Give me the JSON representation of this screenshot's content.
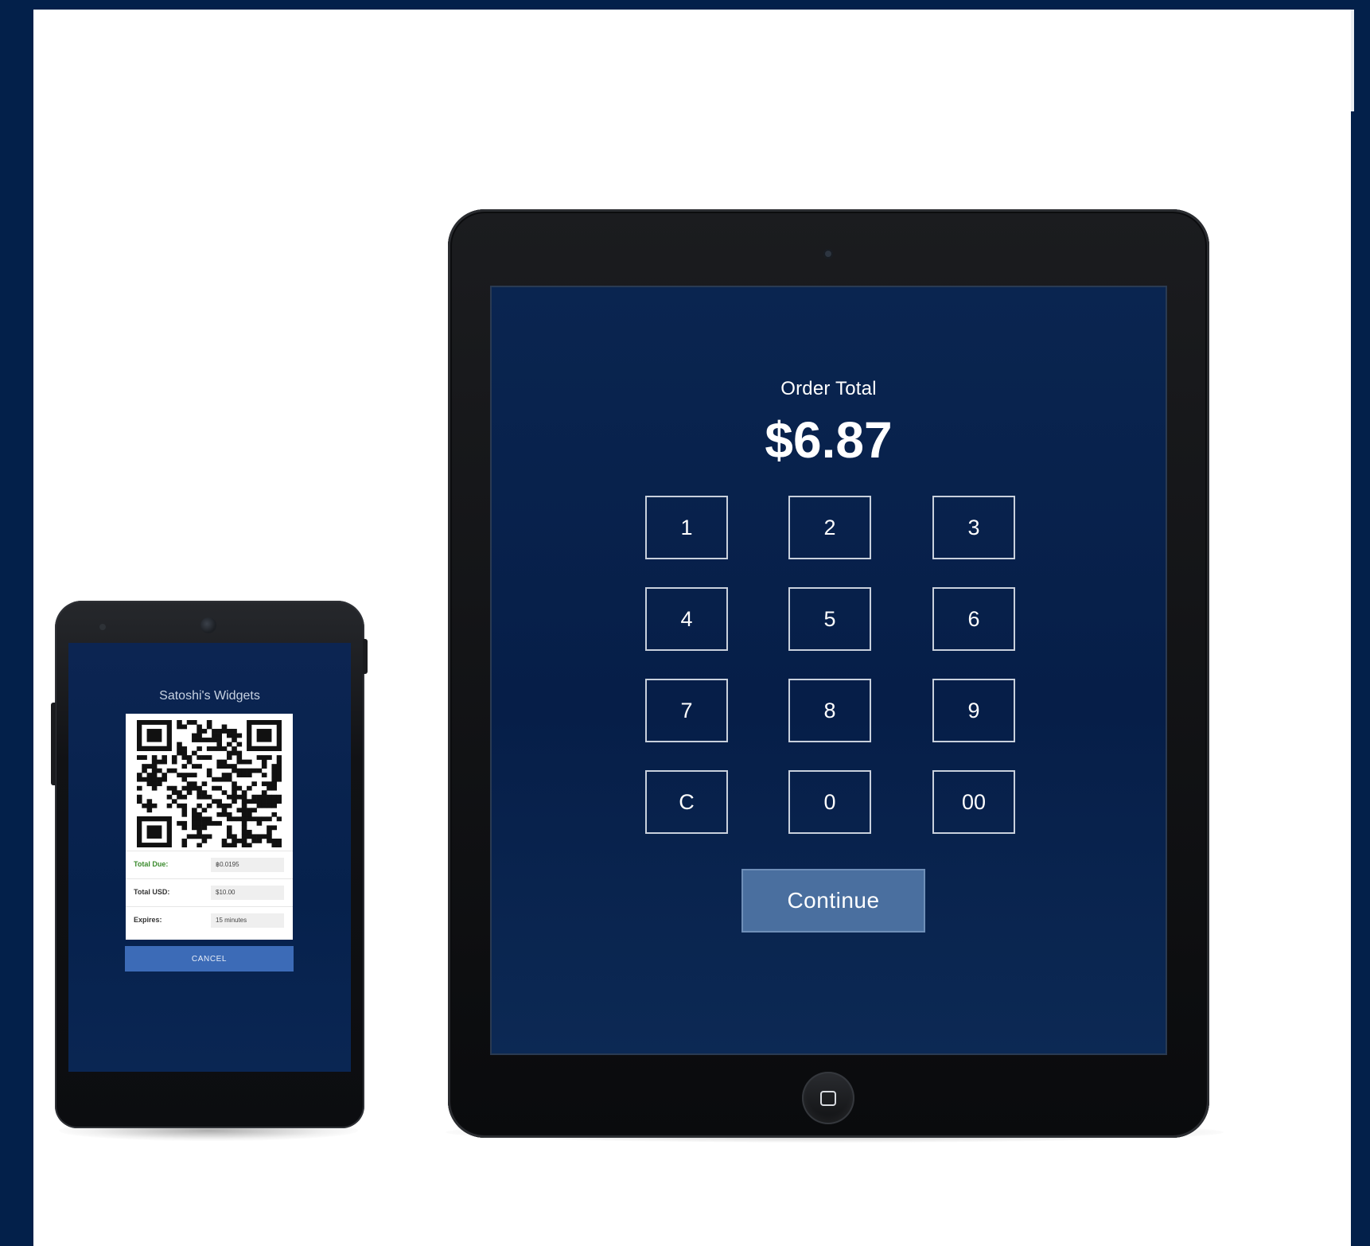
{
  "colors": {
    "frame": "#03204a",
    "screen_bg": "#061e48",
    "continue_bg": "#4a6f9f",
    "cancel_bg": "#3c6bb7",
    "total_due_label": "#3a8a2c"
  },
  "tablet": {
    "order_title": "Order Total",
    "order_amount": "$6.87",
    "keys": [
      "1",
      "2",
      "3",
      "4",
      "5",
      "6",
      "7",
      "8",
      "9",
      "C",
      "0",
      "00"
    ],
    "continue_label": "Continue",
    "home_icon": "home-button-icon"
  },
  "phone": {
    "store_name": "Satoshi's Widgets",
    "qr_icon": "qr-code",
    "rows": [
      {
        "label": "Total Due:",
        "value": "฿0.0195"
      },
      {
        "label": "Total USD:",
        "value": "$10.00"
      },
      {
        "label": "Expires:",
        "value": "15 minutes"
      }
    ],
    "cancel_label": "CANCEL"
  }
}
